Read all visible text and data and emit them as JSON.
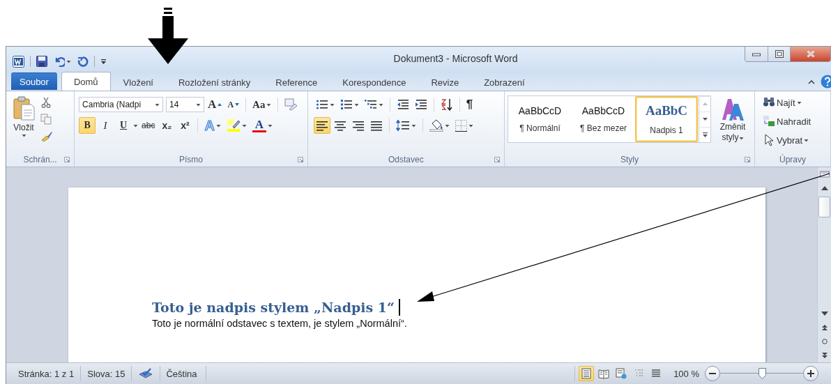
{
  "window": {
    "title": "Dokument3 - Microsoft Word"
  },
  "tabs": [
    {
      "label": "Soubor",
      "kind": "file",
      "selected": false
    },
    {
      "label": "Domů",
      "kind": "tab",
      "selected": true
    },
    {
      "label": "Vložení",
      "kind": "tab",
      "selected": false
    },
    {
      "label": "Rozložení stránky",
      "kind": "tab",
      "selected": false
    },
    {
      "label": "Reference",
      "kind": "tab",
      "selected": false
    },
    {
      "label": "Korespondence",
      "kind": "tab",
      "selected": false
    },
    {
      "label": "Revize",
      "kind": "tab",
      "selected": false
    },
    {
      "label": "Zobrazení",
      "kind": "tab",
      "selected": false
    }
  ],
  "ribbon": {
    "clipboard": {
      "paste_label": "Vložit",
      "group_label": "Schrán..."
    },
    "font": {
      "font_name": "Cambria (Nadpi",
      "font_size": "14",
      "size_buttons": [
        "A",
        "A"
      ],
      "case_button": "Aa",
      "format_buttons": [
        {
          "label": "B",
          "on": true
        },
        {
          "label": "I",
          "on": false
        },
        {
          "label": "U",
          "on": false
        },
        {
          "label": "abc",
          "on": false
        },
        {
          "label": "x₂",
          "on": false
        },
        {
          "label": "x²",
          "on": false
        }
      ],
      "effects_button": "A",
      "color_button": "A",
      "group_label": "Písmo"
    },
    "paragraph": {
      "show_marks": "¶",
      "alignment": [
        {
          "selected": true
        },
        {
          "selected": false
        },
        {
          "selected": false
        },
        {
          "selected": false
        }
      ],
      "group_label": "Odstavec"
    },
    "styles": {
      "items": [
        {
          "preview": "AaBbCcD",
          "name": "¶ Normální",
          "kind": "body",
          "selected": false
        },
        {
          "preview": "AaBbCcD",
          "name": "¶ Bez mezer",
          "kind": "body",
          "selected": false
        },
        {
          "preview": "AaBbC",
          "name": "Nadpis 1",
          "kind": "heading",
          "selected": true
        }
      ],
      "change_styles": "Změnit styly",
      "group_label": "Styly"
    },
    "editing": {
      "items": [
        {
          "label": "Najít",
          "dropdown": true
        },
        {
          "label": "Nahradit",
          "dropdown": false
        },
        {
          "label": "Vybrat",
          "dropdown": true
        }
      ],
      "group_label": "Úpravy"
    }
  },
  "document": {
    "heading": "Toto je nadpis stylem „Nadpis 1“",
    "paragraph": "Toto je normální odstavec s textem, je stylem „Normální“."
  },
  "status_bar": {
    "page": "Stránka: 1 z 1",
    "words": "Slova: 15",
    "language": "Čeština",
    "views": [
      {
        "selected": true
      },
      {
        "selected": false
      },
      {
        "selected": false
      },
      {
        "selected": false
      },
      {
        "selected": false
      }
    ],
    "zoom": "100 %",
    "zoom_slider": {
      "level": 0.5
    }
  }
}
